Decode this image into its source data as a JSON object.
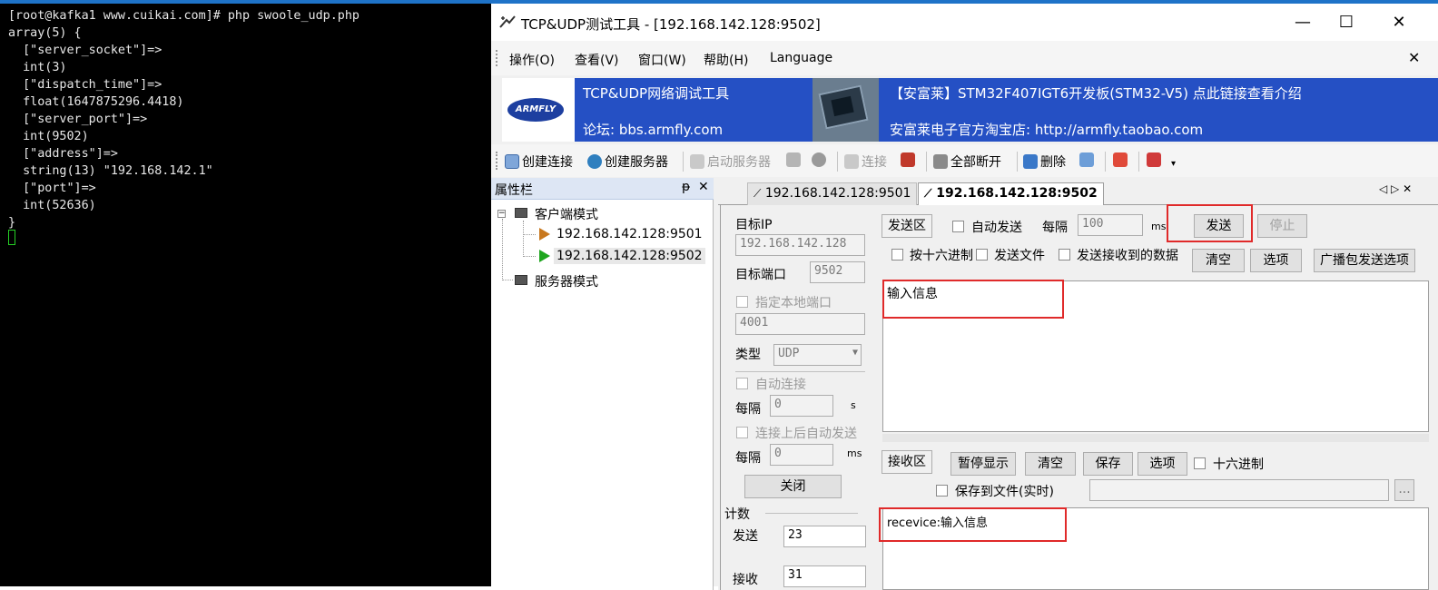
{
  "terminal": {
    "lines": [
      "[root@kafka1 www.cuikai.com]# php swoole_udp.php",
      "array(5) {",
      "  [\"server_socket\"]=>",
      "  int(3)",
      "  [\"dispatch_time\"]=>",
      "  float(1647875296.4418)",
      "  [\"server_port\"]=>",
      "  int(9502)",
      "  [\"address\"]=>",
      "  string(13) \"192.168.142.1\"",
      "  [\"port\"]=>",
      "  int(52636)",
      "}"
    ]
  },
  "window": {
    "title": "TCP&UDP测试工具 - [192.168.142.128:9502]",
    "controls": {
      "minimize": "—",
      "maximize": "☐",
      "close": "✕"
    }
  },
  "menu": {
    "items": [
      "操作(O)",
      "查看(V)",
      "窗口(W)",
      "帮助(H)",
      "Language"
    ],
    "close_glyph": "✕"
  },
  "banner": {
    "logo": "ARMFLY",
    "tool_name": "TCP&UDP网络调试工具",
    "forum": "论坛: bbs.armfly.com",
    "ad": "【安富莱】STM32F407IGT6开发板(STM32-V5) 点此链接查看介绍",
    "shop": "安富莱电子官方淘宝店: http://armfly.taobao.com"
  },
  "toolbar": {
    "create_connection": "创建连接",
    "create_server": "创建服务器",
    "start_server": "启动服务器",
    "connect": "连接",
    "disconnect_all": "全部断开",
    "delete": "删除"
  },
  "properties": {
    "title": "属性栏",
    "pin": "ᵽ",
    "close": "✕",
    "client_mode": "客户端模式",
    "connections": [
      "192.168.142.128:9501",
      "192.168.142.128:9502"
    ],
    "server_mode": "服务器模式"
  },
  "tabs": {
    "items": [
      "192.168.142.128:9501",
      "192.168.142.128:9502"
    ],
    "active_index": 1,
    "nav": "◁ ▷ ✕"
  },
  "settings": {
    "target_ip_label": "目标IP",
    "target_ip": "192.168.142.128",
    "target_port_label": "目标端口",
    "target_port": "9502",
    "local_port_label": "指定本地端口",
    "local_port": "4001",
    "type_label": "类型",
    "type_value": "UDP",
    "auto_connect_label": "自动连接",
    "interval_label": "每隔",
    "interval1_value": "0",
    "interval1_unit": "s",
    "auto_send_after_connect": "连接上后自动发送",
    "interval2_value": "0",
    "interval2_unit": "ms",
    "close_button": "关闭",
    "count_label": "计数",
    "send_label": "发送",
    "send_count": "23",
    "recv_label": "接收",
    "recv_count": "31"
  },
  "send_area": {
    "title": "发送区",
    "auto_send": "自动发送",
    "every": "每隔",
    "interval_value": "100",
    "interval_unit": "ms",
    "send_button": "发送",
    "stop_button": "停止",
    "hex_send": "按十六进制",
    "send_file": "发送文件",
    "send_received": "发送接收到的数据",
    "clear_button": "清空",
    "options_button": "选项",
    "broadcast_options": "广播包发送选项",
    "text": "输入信息"
  },
  "receive_area": {
    "title": "接收区",
    "pause_button": "暂停显示",
    "clear_button": "清空",
    "save_button": "保存",
    "options_button": "选项",
    "hex_label": "十六进制",
    "save_to_file": "保存到文件(实时)",
    "browse": "...",
    "text": "recevice:输入信息"
  },
  "colors": {
    "banner_blue": "#2550c4",
    "highlight_red": "#e02a2a",
    "terminal_bg": "#000000",
    "cursor_green": "#25d025"
  }
}
